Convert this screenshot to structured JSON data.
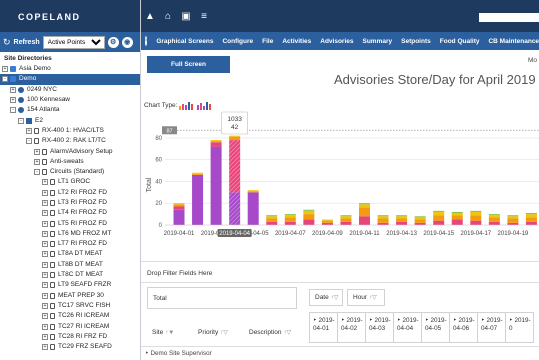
{
  "brand": {
    "name": "COPELAND"
  },
  "sidebar": {
    "refresh_label": "Refresh",
    "points_select": "Active Points",
    "tree_title": "Site Directories",
    "tree": [
      {
        "label": "Asia Demo",
        "indent": 0,
        "icon": "blue",
        "exp": "+"
      },
      {
        "label": "Demo",
        "indent": 0,
        "icon": "blue",
        "exp": "-",
        "selected": true
      },
      {
        "label": "0249 NYC",
        "indent": 1,
        "icon": "dot",
        "exp": "+"
      },
      {
        "label": "100 Kennesaw",
        "indent": 1,
        "icon": "dot",
        "exp": "+"
      },
      {
        "label": "154 Atlanta",
        "indent": 1,
        "icon": "dot",
        "exp": "-"
      },
      {
        "label": "E2",
        "indent": 2,
        "icon": "bar",
        "exp": "-"
      },
      {
        "label": "RX-400 1: HVAC/LTS",
        "indent": 3,
        "icon": "box",
        "exp": "+"
      },
      {
        "label": "RX-400 2: RAK LT/TC",
        "indent": 3,
        "icon": "box",
        "exp": "-"
      },
      {
        "label": "Alarm/Advisory Setup",
        "indent": 4,
        "icon": "box",
        "exp": "+"
      },
      {
        "label": "Anti-sweats",
        "indent": 4,
        "icon": "box",
        "exp": "+"
      },
      {
        "label": "Circuits (Standard)",
        "indent": 4,
        "icon": "box",
        "exp": "-"
      },
      {
        "label": "LT1 GROC",
        "indent": 5,
        "icon": "box",
        "exp": "+"
      },
      {
        "label": "LT2 RI FROZ FD",
        "indent": 5,
        "icon": "box",
        "exp": "+"
      },
      {
        "label": "LT3 RI FROZ FD",
        "indent": 5,
        "icon": "box",
        "exp": "+"
      },
      {
        "label": "LT4 RI FROZ FD",
        "indent": 5,
        "icon": "box",
        "exp": "+"
      },
      {
        "label": "LT5 RI FROZ FD",
        "indent": 5,
        "icon": "box",
        "exp": "+"
      },
      {
        "label": "LT6 MD FROZ MT",
        "indent": 5,
        "icon": "box",
        "exp": "+"
      },
      {
        "label": "LT7 RI FROZ FD",
        "indent": 5,
        "icon": "box",
        "exp": "+"
      },
      {
        "label": "LT8A DT MEAT",
        "indent": 5,
        "icon": "box",
        "exp": "+"
      },
      {
        "label": "LT8B DT MEAT",
        "indent": 5,
        "icon": "box",
        "exp": "+"
      },
      {
        "label": "LT8C DT MEAT",
        "indent": 5,
        "icon": "box",
        "exp": "+"
      },
      {
        "label": "LT9 SEAFD FRZR",
        "indent": 5,
        "icon": "box",
        "exp": "+"
      },
      {
        "label": "MEAT PREP 30",
        "indent": 5,
        "icon": "box",
        "exp": "+"
      },
      {
        "label": "TC17 SRVC FISH",
        "indent": 5,
        "icon": "box",
        "exp": "+"
      },
      {
        "label": "TC26 RI ICREAM",
        "indent": 5,
        "icon": "box",
        "exp": "+"
      },
      {
        "label": "TC27 RI ICREAM",
        "indent": 5,
        "icon": "box",
        "exp": "+"
      },
      {
        "label": "TC28 RI FRZ FD",
        "indent": 5,
        "icon": "box",
        "exp": "+"
      },
      {
        "label": "TC29 FRZ SEAFD",
        "indent": 5,
        "icon": "box",
        "exp": "+"
      }
    ]
  },
  "topnav": {
    "icons": [
      "warning-icon",
      "home-icon",
      "image-icon",
      "menu-icon"
    ],
    "glyphs": [
      "▲",
      "⌂",
      "▣",
      "≡"
    ]
  },
  "menu": [
    "Graphical Screens",
    "Configure",
    "File",
    "Activities",
    "Advisories",
    "Summary",
    "Setpoints",
    "Food Quality",
    "CB Maintenance"
  ],
  "main": {
    "fullscreen_label": "Full Screen",
    "mo_label": "Mo",
    "chart_type_label": "Chart Type:",
    "drop_filter": "Drop Filter Fields Here",
    "total_label": "Total",
    "date_label": "Date",
    "hour_label": "Hour",
    "site_label": "Site",
    "priority_label": "Priority",
    "description_label": "Description",
    "date_cols": [
      [
        "‣ 2019-",
        "04-01"
      ],
      [
        "‣ 2019-",
        "04-02"
      ],
      [
        "‣ 2019-",
        "04-03"
      ],
      [
        "‣ 2019-",
        "04-04"
      ],
      [
        "‣ 2019-",
        "04-05"
      ],
      [
        "‣ 2019-",
        "04-06"
      ],
      [
        "‣ 2019-",
        "04-07"
      ],
      [
        "‣ 2019-",
        "0"
      ]
    ],
    "supervisor": "‣ Demo Site Supervisor"
  },
  "colors": {
    "navy": "#1e3a5f",
    "blue": "#2c5f9e",
    "purple": "#a64ac9",
    "pink": "#e8467a",
    "orange": "#f39c12",
    "yellow": "#f1c40f",
    "green": "#8bc34a",
    "red": "#e74c3c"
  },
  "chart_data": {
    "type": "bar",
    "title": "Advisories Store/Day for April 2019",
    "ylabel": "Total",
    "ylim": [
      0,
      90
    ],
    "yticks": [
      0,
      20,
      40,
      60,
      80
    ],
    "ymax_badge": "87",
    "x_ticklabels": [
      "2019-04-01",
      "2019-04-03",
      "2019-04-05",
      "2019-04-07",
      "2019-04-09",
      "2019-04-11",
      "2019-04-13",
      "2019-04-15",
      "2019-04-17",
      "2019-04-19"
    ],
    "highlight_label": "2019-04-04",
    "categories": [
      "2019-04-01",
      "2019-04-02",
      "2019-04-03",
      "2019-04-04",
      "2019-04-05",
      "2019-04-06",
      "2019-04-07",
      "2019-04-08",
      "2019-04-09",
      "2019-04-10",
      "2019-04-11",
      "2019-04-12",
      "2019-04-13",
      "2019-04-14",
      "2019-04-15",
      "2019-04-16",
      "2019-04-17",
      "2019-04-18",
      "2019-04-19",
      "2019-04-20"
    ],
    "series": [
      {
        "color": "#a64ac9",
        "values": [
          14,
          46,
          72,
          30,
          30,
          0,
          0,
          0,
          0,
          0,
          0,
          0,
          0,
          0,
          0,
          0,
          0,
          0,
          0,
          0
        ]
      },
      {
        "color": "#e8467a",
        "values": [
          3,
          0,
          4,
          48,
          0,
          3,
          3,
          5,
          2,
          3,
          8,
          2,
          3,
          2,
          4,
          5,
          4,
          3,
          2,
          3
        ]
      },
      {
        "color": "#f39c12",
        "values": [
          2,
          1,
          1,
          3,
          1,
          3,
          4,
          5,
          2,
          3,
          8,
          4,
          3,
          3,
          5,
          4,
          5,
          4,
          4,
          4
        ]
      },
      {
        "color": "#f1c40f",
        "values": [
          1,
          1,
          1,
          1,
          1,
          2,
          2,
          3,
          1,
          2,
          3,
          2,
          2,
          2,
          3,
          2,
          3,
          2,
          2,
          3
        ]
      },
      {
        "color": "#8bc34a",
        "values": [
          0,
          0,
          0,
          0,
          0,
          1,
          1,
          1,
          0,
          1,
          1,
          1,
          1,
          1,
          1,
          1,
          1,
          1,
          1,
          1
        ]
      }
    ],
    "tooltip": {
      "lines": [
        "1033",
        "42"
      ]
    }
  }
}
